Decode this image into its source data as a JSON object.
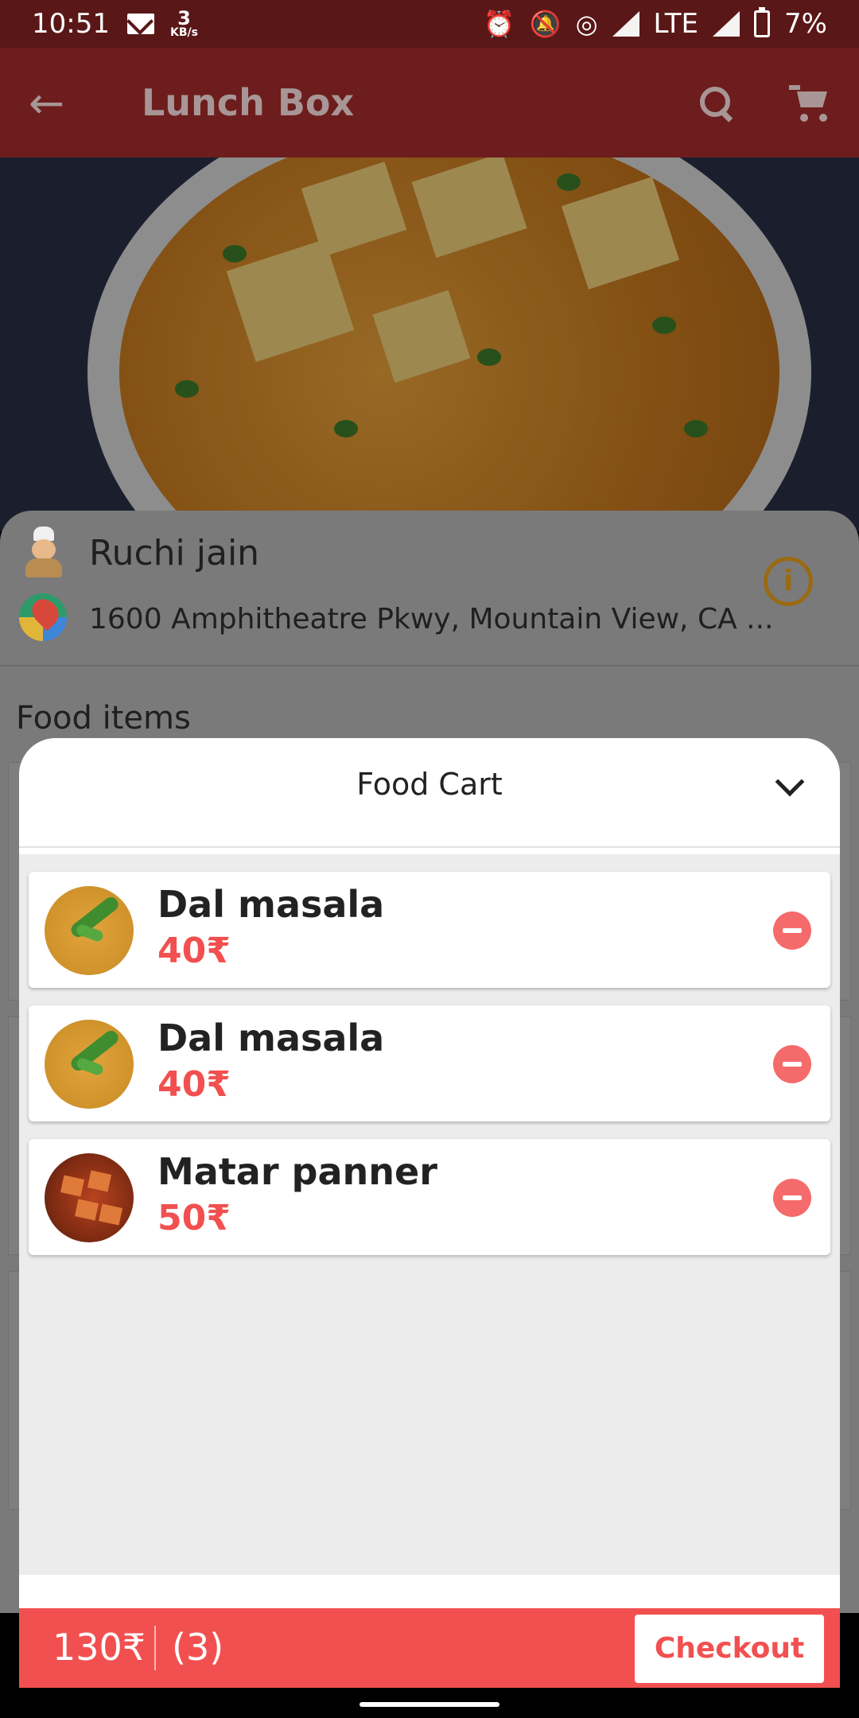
{
  "status_bar": {
    "time": "10:51",
    "data_rate_value": "3",
    "data_rate_unit": "KB/s",
    "network": "LTE",
    "battery": "7%"
  },
  "app_bar": {
    "title": "Lunch Box",
    "back_icon": "arrow-back-icon",
    "search_icon": "search-icon",
    "cart_icon": "shopping-cart-icon"
  },
  "chef": {
    "name": "Ruchi jain",
    "address": "1600 Amphitheatre Pkwy, Mountain View, CA ...",
    "info_symbol": "i"
  },
  "food_section": {
    "title": "Food items"
  },
  "cart": {
    "title": "Food Cart",
    "items": [
      {
        "name": "Dal masala",
        "price": "40₹",
        "image": "dal"
      },
      {
        "name": "Dal masala",
        "price": "40₹",
        "image": "dal"
      },
      {
        "name": "Matar panner",
        "price": "50₹",
        "image": "paneer"
      }
    ],
    "total": "130₹",
    "count": "(3)",
    "checkout_label": "Checkout"
  },
  "colors": {
    "accent": "#f25050",
    "app_bar": "#6d1d1d",
    "status_bar": "#5a1717"
  }
}
